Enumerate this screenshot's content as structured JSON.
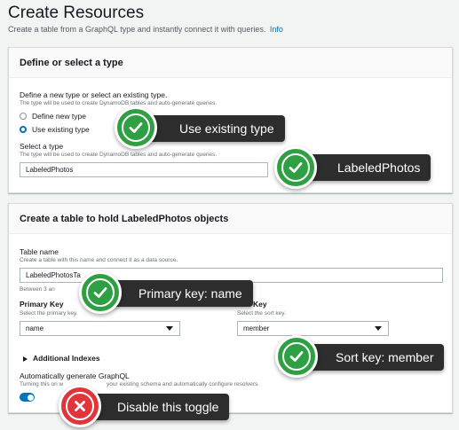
{
  "header": {
    "title": "Create Resources",
    "subtitle": "Create a table from a GraphQL type and instantly connect it with queries.",
    "info_link": "Info"
  },
  "type_panel": {
    "title": "Define or select a type",
    "question": "Define a new type or select an existing type.",
    "question_desc": "The type will be used to create DynamoDB tables and auto-generate queries.",
    "options": [
      "Define new type",
      "Use existing type"
    ],
    "selected_option": "Use existing type",
    "select_label": "Select a type",
    "select_desc": "The type will be used to create DynamoDB tables and auto-generate queries.",
    "select_value": "LabeledPhotos"
  },
  "table_panel": {
    "title": "Create a table to hold LabeledPhotos objects",
    "table_name_label": "Table name",
    "table_name_desc": "Create a table with this name and connect it as a data source.",
    "table_name_value": "LabeledPhotosTa",
    "table_name_hint": "Between 3 an",
    "primary_key_label": "Primary Key",
    "primary_key_desc": "Select the primary key.",
    "primary_key_value": "name",
    "sort_key_label": "Key",
    "sort_key_desc": "Select the sort key.",
    "sort_key_value": "member",
    "additional_indexes": "Additional Indexes",
    "auto_graphql_label": "Automatically generate GraphQL",
    "auto_graphql_desc_a": "Turning this on w",
    "auto_graphql_desc_b": "your existing schema and automatically configure resolvers.",
    "auto_graphql_on": true
  },
  "callouts": [
    {
      "text": "Use existing type",
      "kind": "check"
    },
    {
      "text": "LabeledPhotos",
      "kind": "check"
    },
    {
      "text": "Primary key: name",
      "kind": "check"
    },
    {
      "text": "Sort key: member",
      "kind": "check"
    },
    {
      "text": "Disable this toggle",
      "kind": "cross"
    }
  ],
  "colors": {
    "accent": "#0073bb",
    "callout_bg": "#2d2d2d",
    "check_green": "#2ea043",
    "cross_red": "#e0353b"
  },
  "icons": [
    "checkmark-icon",
    "cross-icon",
    "caret-down-icon",
    "expand-triangle-icon"
  ]
}
